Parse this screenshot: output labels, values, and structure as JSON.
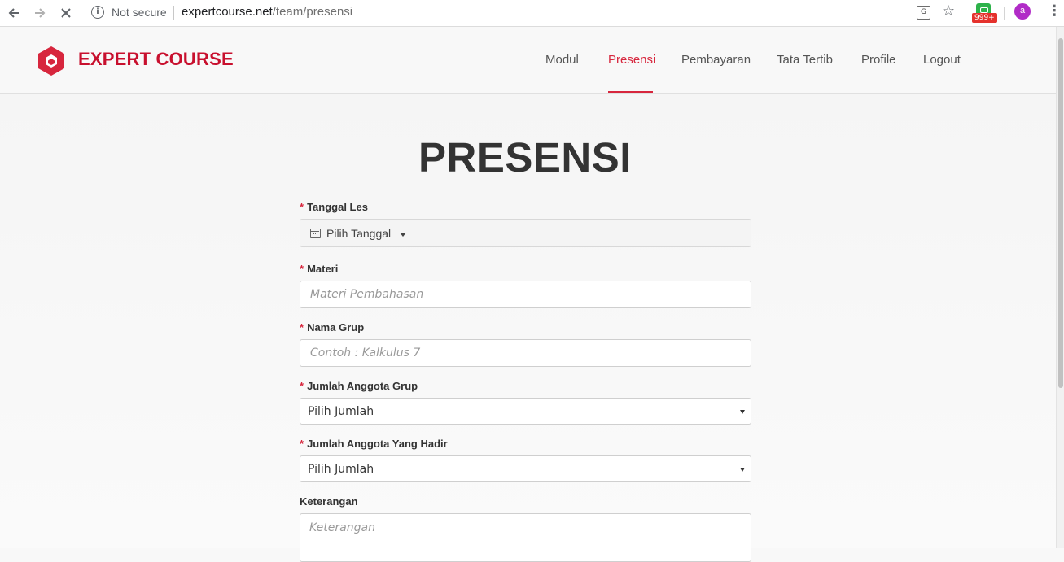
{
  "browser": {
    "security_label": "Not secure",
    "url_domain": "expertcourse.net",
    "url_path": "/team/presensi",
    "extension_badge": "999+",
    "avatar_letter": "a"
  },
  "header": {
    "brand": "EXPERT COURSE",
    "brand_color": "#c8102e",
    "nav": [
      {
        "label": "Modul",
        "active": false
      },
      {
        "label": "Presensi",
        "active": true
      },
      {
        "label": "Pembayaran",
        "active": false
      },
      {
        "label": "Tata Tertib",
        "active": false
      },
      {
        "label": "Profile",
        "active": false
      },
      {
        "label": "Logout",
        "active": false
      }
    ]
  },
  "form": {
    "title": "PRESENSI",
    "required_mark": "*",
    "tanggal": {
      "label": "Tanggal Les",
      "value": "Pilih Tanggal",
      "icon": "calendar-icon"
    },
    "materi": {
      "label": "Materi",
      "placeholder": "Materi Pembahasan"
    },
    "nama_grup": {
      "label": "Nama Grup",
      "placeholder": "Contoh : Kalkulus 7"
    },
    "jumlah_anggota": {
      "label": "Jumlah Anggota Grup",
      "value": "Pilih Jumlah"
    },
    "jumlah_hadir": {
      "label": "Jumlah Anggota Yang Hadir",
      "value": "Pilih Jumlah"
    },
    "keterangan": {
      "label": "Keterangan",
      "placeholder": "Keterangan"
    }
  }
}
